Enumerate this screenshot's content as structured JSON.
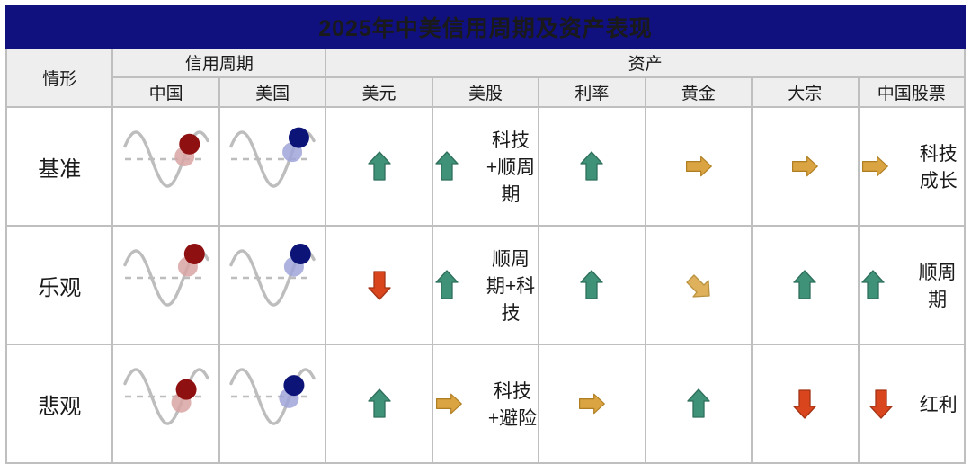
{
  "title": "2025年中美信用周期及资产表现",
  "colors": {
    "title_bg": "#10107e",
    "title_text": "#ffffff",
    "header_bg": "#eeeeee",
    "grid": "#bfbfbf",
    "up_arrow": "#3f9177",
    "down_arrow": "#d9461e",
    "flat_arrow": "#d9a441",
    "diag_arrow": "#e0b15c",
    "china_dot": "#8f1010",
    "china_dot_faded": "#d9a5a5",
    "us_dot": "#0d1478",
    "us_dot_faded": "#a0a4d8",
    "curve": "#bdbdbd"
  },
  "header": {
    "situation": "情形",
    "group_credit_cycle": "信用周期",
    "group_assets": "资产",
    "columns": [
      "中国",
      "美国",
      "美元",
      "美股",
      "利率",
      "黄金",
      "大宗",
      "中国股票"
    ]
  },
  "rows": [
    {
      "scenario": "基准",
      "china_cycle": {
        "position": "rising-from-trough",
        "solid_dot_phase": 0.78,
        "faded_dot_phase": 0.72
      },
      "us_cycle": {
        "position": "rising-from-trough",
        "solid_dot_phase": 0.82,
        "faded_dot_phase": 0.74
      },
      "usd": {
        "direction": "up",
        "label": ""
      },
      "us_equity": {
        "direction": "up",
        "label": "科技+顺周期"
      },
      "rates": {
        "direction": "up",
        "label": ""
      },
      "gold": {
        "direction": "flat",
        "label": ""
      },
      "commodity": {
        "direction": "flat",
        "label": ""
      },
      "china_equity": {
        "direction": "flat",
        "label": "科技成长"
      }
    },
    {
      "scenario": "乐观",
      "china_cycle": {
        "position": "mid-recovery",
        "solid_dot_phase": 0.84,
        "faded_dot_phase": 0.76
      },
      "us_cycle": {
        "position": "mid-recovery",
        "solid_dot_phase": 0.84,
        "faded_dot_phase": 0.76
      },
      "usd": {
        "direction": "down",
        "label": ""
      },
      "us_equity": {
        "direction": "up",
        "label": "顺周期+科技"
      },
      "rates": {
        "direction": "up",
        "label": ""
      },
      "gold": {
        "direction": "down-right",
        "label": ""
      },
      "commodity": {
        "direction": "up",
        "label": ""
      },
      "china_equity": {
        "direction": "up",
        "label": "顺周期"
      }
    },
    {
      "scenario": "悲观",
      "china_cycle": {
        "position": "at-trough",
        "solid_dot_phase": 0.74,
        "faded_dot_phase": 0.68
      },
      "us_cycle": {
        "position": "at-trough",
        "solid_dot_phase": 0.76,
        "faded_dot_phase": 0.7
      },
      "usd": {
        "direction": "up",
        "label": ""
      },
      "us_equity": {
        "direction": "flat",
        "label": "科技+避险"
      },
      "rates": {
        "direction": "flat",
        "label": ""
      },
      "gold": {
        "direction": "up",
        "label": ""
      },
      "commodity": {
        "direction": "down",
        "label": ""
      },
      "china_equity": {
        "direction": "down",
        "label": "红利"
      }
    }
  ]
}
